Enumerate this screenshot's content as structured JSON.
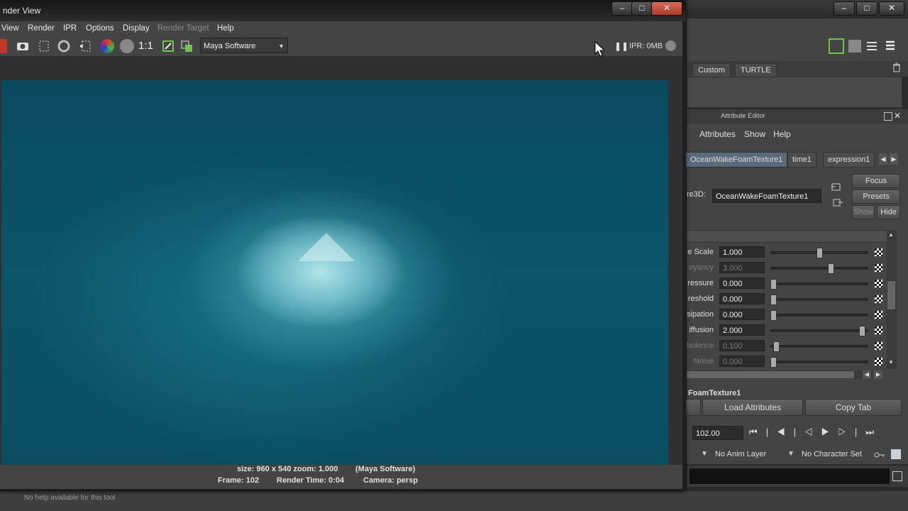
{
  "main_window": {
    "shelf_tabs": [
      "Custom",
      "TURTLE"
    ],
    "attribute_editor": {
      "title": "Attribute Editor",
      "menus": [
        "Attributes",
        "Show",
        "Help"
      ],
      "tabs": [
        "OceanWakeFoamTexture1",
        "time1",
        "expression1"
      ],
      "node_label": "re3D:",
      "node_name": "OceanWakeFoamTexture1",
      "focus_label": "Focus",
      "presets_label": "Presets",
      "show_label": "Show",
      "hide_label": "Hide",
      "section_title": "FoamTexture1",
      "attributes": [
        {
          "label": "e Scale",
          "value": "1.000",
          "level": 0.5,
          "enabled": true
        },
        {
          "label": "oyancy",
          "value": "3.000",
          "level": 0.62,
          "enabled": false
        },
        {
          "label": "ressure",
          "value": "0.000",
          "level": 0.0,
          "enabled": true
        },
        {
          "label": "reshold",
          "value": "0.000",
          "level": 0.0,
          "enabled": true
        },
        {
          "label": "sipation",
          "value": "0.000",
          "level": 0.0,
          "enabled": true
        },
        {
          "label": "iffusion",
          "value": "2.000",
          "level": 0.96,
          "enabled": true
        },
        {
          "label": "bulence",
          "value": "0.100",
          "level": 0.03,
          "enabled": false
        },
        {
          "label": "Noise",
          "value": "0.000",
          "level": 0.0,
          "enabled": false
        }
      ],
      "load_attributes_label": "Load Attributes",
      "copy_tab_label": "Copy Tab"
    },
    "time_field": "102.00",
    "anim_layer": "No Anim Layer",
    "character_set": "No Character Set",
    "help_line": "No help available for this tool"
  },
  "render_view": {
    "title": "nder View",
    "menus": [
      "View",
      "Render",
      "IPR",
      "Options",
      "Display",
      "Render Target",
      "Help"
    ],
    "menu_disabled": [
      false,
      false,
      false,
      false,
      false,
      true,
      false
    ],
    "ratio_label": "1:1",
    "renderer": "Maya Software",
    "ipr_status": "IPR: 0MB",
    "info_line1": "size: 960 x 540 zoom: 1.000",
    "info_line1_renderer": "(Maya Software)",
    "info_frame": "Frame: 102",
    "info_render_time": "Render Time: 0:04",
    "info_camera": "Camera: persp"
  }
}
